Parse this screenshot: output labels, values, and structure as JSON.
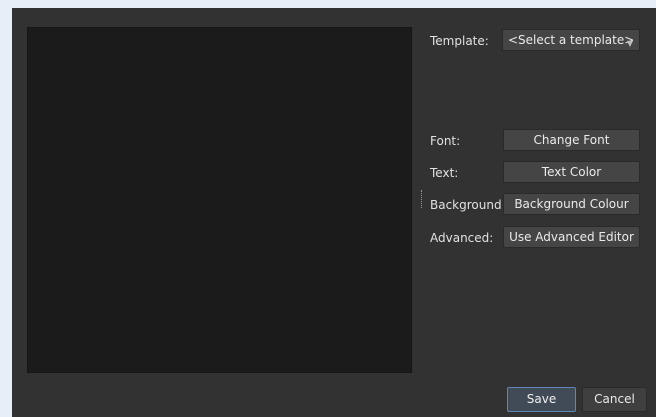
{
  "form": {
    "template_label": "Template:",
    "template_value": "<Select a template>",
    "font_label": "Font:",
    "font_button": "Change Font",
    "text_label": "Text:",
    "text_button": "Text Color",
    "background_label": "Background:",
    "background_button": "Background Colour",
    "advanced_label": "Advanced:",
    "advanced_button": "Use Advanced Editor"
  },
  "footer": {
    "save": "Save",
    "cancel": "Cancel"
  },
  "icons": {
    "dropdown": "chevron-down-icon"
  },
  "colors": {
    "dialog_background": "#323232",
    "preview_background": "#1b1b1b",
    "button_background": "#454545",
    "focus_border": "#5f86b8",
    "outer_background": "#e7eef8"
  }
}
